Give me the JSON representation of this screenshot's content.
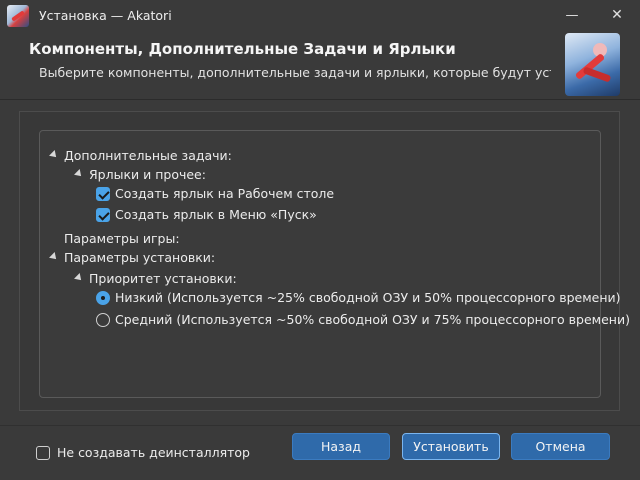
{
  "window": {
    "title": "Установка — Akatori",
    "minimize_glyph": "—",
    "close_glyph": "✕"
  },
  "header": {
    "title": "Компоненты, Дополнительные Задачи и Ярлыки",
    "subtitle": "Выберите компоненты, дополнительные задачи и ярлыки, которые будут установлены"
  },
  "tree": {
    "additional_tasks": "Дополнительные задачи:",
    "shortcuts_group": "Ярлыки и прочее:",
    "desktop_shortcut": {
      "label": "Создать ярлык на Рабочем столе",
      "checked": true
    },
    "start_menu_shortcut": {
      "label": "Создать ярлык в Меню «Пуск»",
      "checked": true
    },
    "game_params": "Параметры игры:",
    "install_params": "Параметры установки:",
    "priority_group": "Приоритет установки:",
    "priority_low": {
      "label": "Низкий (Используется ~25% свободной ОЗУ и 50% процессорного времени)",
      "selected": true
    },
    "priority_medium": {
      "label": "Средний (Используется ~50% свободной ОЗУ и 75% процессорного времени)",
      "selected": false
    }
  },
  "footer": {
    "no_uninstaller": {
      "label": "Не создавать деинсталлятор",
      "checked": false
    },
    "back_label": "Назад",
    "install_label": "Установить",
    "cancel_label": "Отмена"
  },
  "colors": {
    "accent": "#4aa3e8",
    "button": "#2f6aaa",
    "background": "#3a3a3a"
  }
}
